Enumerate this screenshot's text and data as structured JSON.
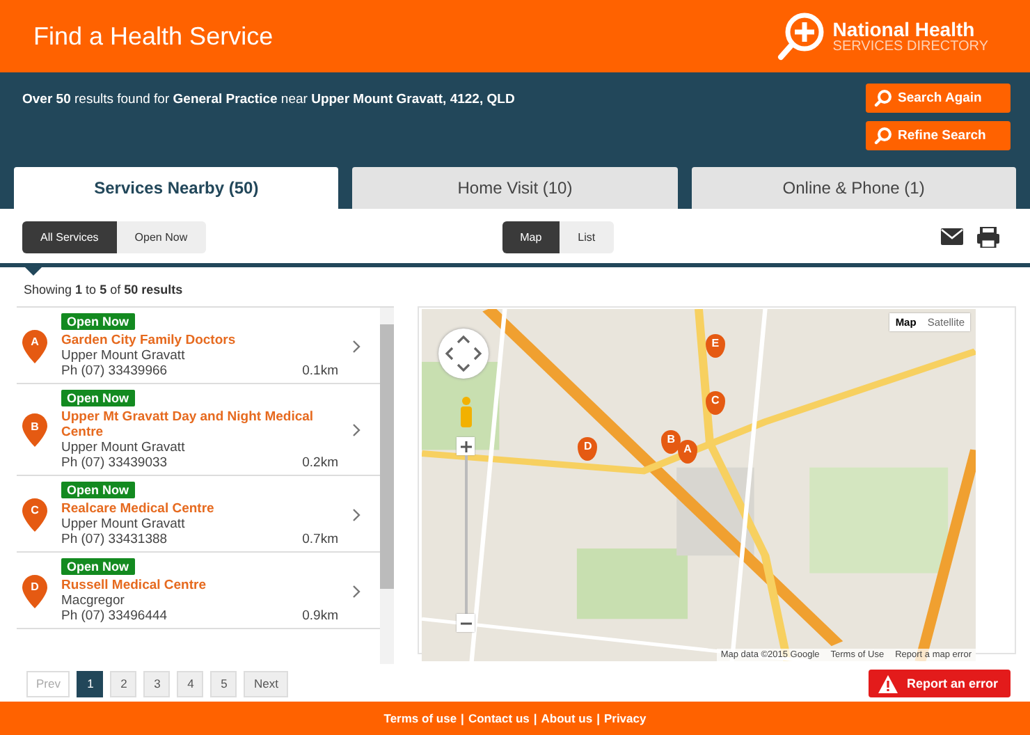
{
  "header": {
    "title": "Find a Health Service",
    "logo_line1": "National Health",
    "logo_line2": "SERVICES DIRECTORY"
  },
  "summary": {
    "text": "**Over 50** results found for **General Practice** near **Upper Mount Gravatt, 4122, QLD**",
    "buttons": [
      "Search Again",
      "Refine Search"
    ]
  },
  "tabs": [
    {
      "label": "Services Nearby (50)",
      "selected": true
    },
    {
      "label": "Home Visit (10)",
      "selected": false
    },
    {
      "label": "Online & Phone (1)",
      "selected": false
    }
  ],
  "filters": [
    {
      "label": "All Services",
      "selected": true
    },
    {
      "label": "Open Now",
      "selected": false
    }
  ],
  "views": [
    {
      "label": "Map",
      "selected": true
    },
    {
      "label": "List",
      "selected": false
    }
  ],
  "showing": "Showing **1** to **5** of **50 results**",
  "results": [
    {
      "letter": "A",
      "status": "Open Now",
      "name": "Garden City Family Doctors",
      "suburb": "Upper Mount Gravatt",
      "phone": "Ph (07) 33439966",
      "distance": "0.1km"
    },
    {
      "letter": "B",
      "status": "Open Now",
      "name": "Upper Mt Gravatt Day and Night Medical Centre",
      "suburb": "Upper Mount Gravatt",
      "phone": "Ph (07) 33439033",
      "distance": "0.2km"
    },
    {
      "letter": "C",
      "status": "Open Now",
      "name": "Realcare Medical Centre",
      "suburb": "Upper Mount Gravatt",
      "phone": "Ph (07) 33431388",
      "distance": "0.7km"
    },
    {
      "letter": "D",
      "status": "Open Now",
      "name": "Russell Medical Centre",
      "suburb": "Macgregor",
      "phone": "Ph (07) 33496444",
      "distance": "0.9km"
    }
  ],
  "map": {
    "types": [
      {
        "label": "Map",
        "selected": true
      },
      {
        "label": "Satellite",
        "selected": false
      }
    ],
    "markers": [
      {
        "label": "E"
      },
      {
        "label": "C"
      },
      {
        "label": "D"
      },
      {
        "label": "B"
      },
      {
        "label": "A"
      }
    ],
    "attribution": [
      "Map data ©2015 Google",
      "Terms of Use",
      "Report a map error"
    ]
  },
  "pagination": {
    "prev": {
      "label": "Prev",
      "disabled": true
    },
    "pages": [
      {
        "label": "1",
        "selected": true
      },
      {
        "label": "2",
        "selected": false
      },
      {
        "label": "3",
        "selected": false
      },
      {
        "label": "4",
        "selected": false
      },
      {
        "label": "5",
        "selected": false
      }
    ],
    "next": {
      "label": "Next",
      "disabled": false
    }
  },
  "report_button": "Report an error",
  "footer": {
    "links": [
      "Terms of use",
      "Contact us",
      "About us",
      "Privacy"
    ],
    "separator": "|"
  }
}
